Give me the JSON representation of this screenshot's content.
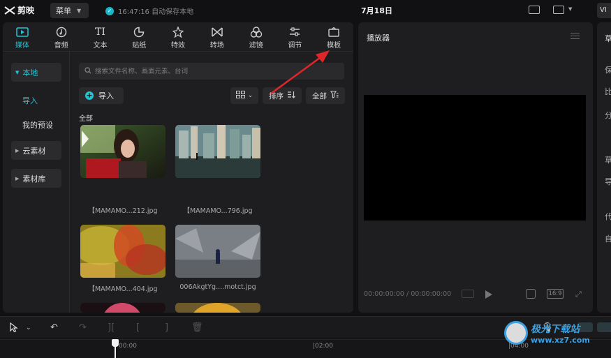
{
  "app": {
    "name": "剪映"
  },
  "titlebar": {
    "menu_label": "菜单",
    "save_status": "16:47:16 自动保存本地",
    "project_title": "7月18日",
    "export_label": "VI"
  },
  "tabs": [
    {
      "label": "媒体",
      "icon": "media-icon",
      "active": true
    },
    {
      "label": "音频",
      "icon": "audio-icon"
    },
    {
      "label": "文本",
      "icon": "text-icon"
    },
    {
      "label": "贴纸",
      "icon": "sticker-icon"
    },
    {
      "label": "特效",
      "icon": "effects-icon"
    },
    {
      "label": "转场",
      "icon": "transition-icon"
    },
    {
      "label": "滤镜",
      "icon": "filter-icon"
    },
    {
      "label": "调节",
      "icon": "adjust-icon"
    },
    {
      "label": "模板",
      "icon": "template-icon"
    }
  ],
  "sidebar": {
    "local": "本地",
    "import": "导入",
    "presets": "我的预设",
    "cloud": "云素材",
    "library": "素材库"
  },
  "search": {
    "placeholder": "搜索文件名称、画面元素、台词"
  },
  "toolbar_media": {
    "import_label": "导入",
    "sort_label": "排序",
    "filter_label": "全部"
  },
  "section_label": "全部",
  "media_items": [
    {
      "name": "【MAMAMO...212.jpg"
    },
    {
      "name": "【MAMAMO...796.jpg"
    },
    {
      "name": "【MAMAMO...404.jpg"
    },
    {
      "name": "006AkgtYg....motct.jpg"
    }
  ],
  "player": {
    "title": "播放器",
    "timecode": "00:00:00:00 / 00:00:00:00",
    "ratio": "16:9"
  },
  "props": [
    "草",
    "保",
    "比",
    "分",
    "草",
    "导",
    "代",
    "自"
  ],
  "timeline": {
    "ticks": [
      "00:00",
      "|02:00",
      "|04:00"
    ]
  },
  "watermark": {
    "name": "极光下载站",
    "url": "www.xz7.com"
  },
  "colors": {
    "accent": "#22c5d6",
    "annotation_arrow": "#e0262b"
  }
}
